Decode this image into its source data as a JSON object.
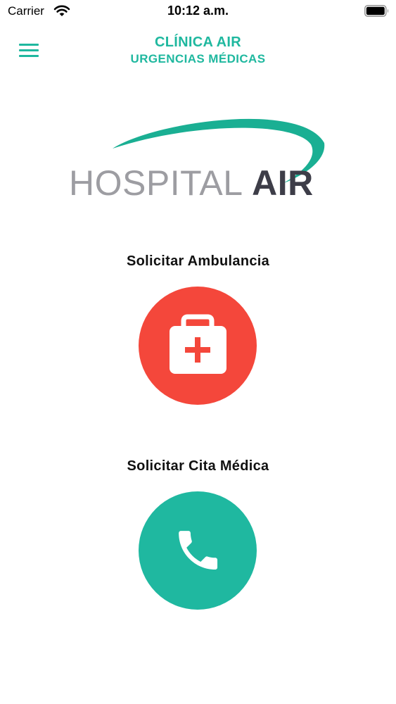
{
  "status_bar": {
    "carrier": "Carrier",
    "time": "10:12 a.m."
  },
  "header": {
    "title": "CLÍNICA AIR",
    "subtitle": "URGENCIAS MÉDICAS",
    "menu_icon": "hamburger-menu-icon"
  },
  "logo": {
    "text_light": "HOSPITAL",
    "text_bold": "AIR"
  },
  "actions": {
    "ambulance": {
      "label": "Solicitar Ambulancia",
      "icon": "medical-kit-icon",
      "color": "#f4473b"
    },
    "appointment": {
      "label": "Solicitar Cita Médica",
      "icon": "phone-icon",
      "color": "#1fb8a0"
    }
  },
  "colors": {
    "accent": "#1fb89f",
    "logo_gray": "#9d9da2",
    "logo_dark": "#3d3d48"
  }
}
